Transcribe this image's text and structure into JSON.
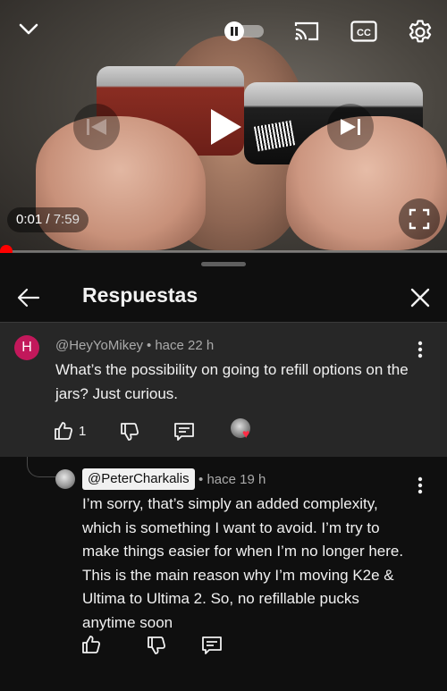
{
  "player": {
    "current_time": "0:01",
    "separator": " / ",
    "duration": "7:59",
    "progress_fraction": 0.002,
    "icons": {
      "minimize": "chevron-down-icon",
      "autoplay": "pause-toggle-icon",
      "cast": "cast-icon",
      "captions": "cc-icon",
      "settings": "gear-icon",
      "previous": "previous-icon",
      "play": "play-icon",
      "next": "next-icon",
      "fullscreen": "fullscreen-icon"
    },
    "cc_label": "CC",
    "accent_color": "#ff0000"
  },
  "panel": {
    "title": "Respuestas",
    "back_icon": "arrow-left-icon",
    "close_icon": "close-icon"
  },
  "parent_comment": {
    "avatar_letter": "H",
    "avatar_color": "#c2185b",
    "author": "@HeyYoMikey",
    "separator": "•",
    "time": "hace 22 h",
    "text": "What’s the possibility on going to refill options on the jars? Just curious.",
    "like_count": "1",
    "creator_heart": true
  },
  "reply": {
    "author": "@PeterCharkalis",
    "separator": "•",
    "time": "hace 19 h",
    "text": "I’m sorry, that’s simply an added complexity, which is something I want to avoid. I’m try to make things easier for when I’m no longer here. This is the main reason why I’m moving K2e & Ultima to Ultima 2. So, no refillable pucks anytime soon"
  }
}
